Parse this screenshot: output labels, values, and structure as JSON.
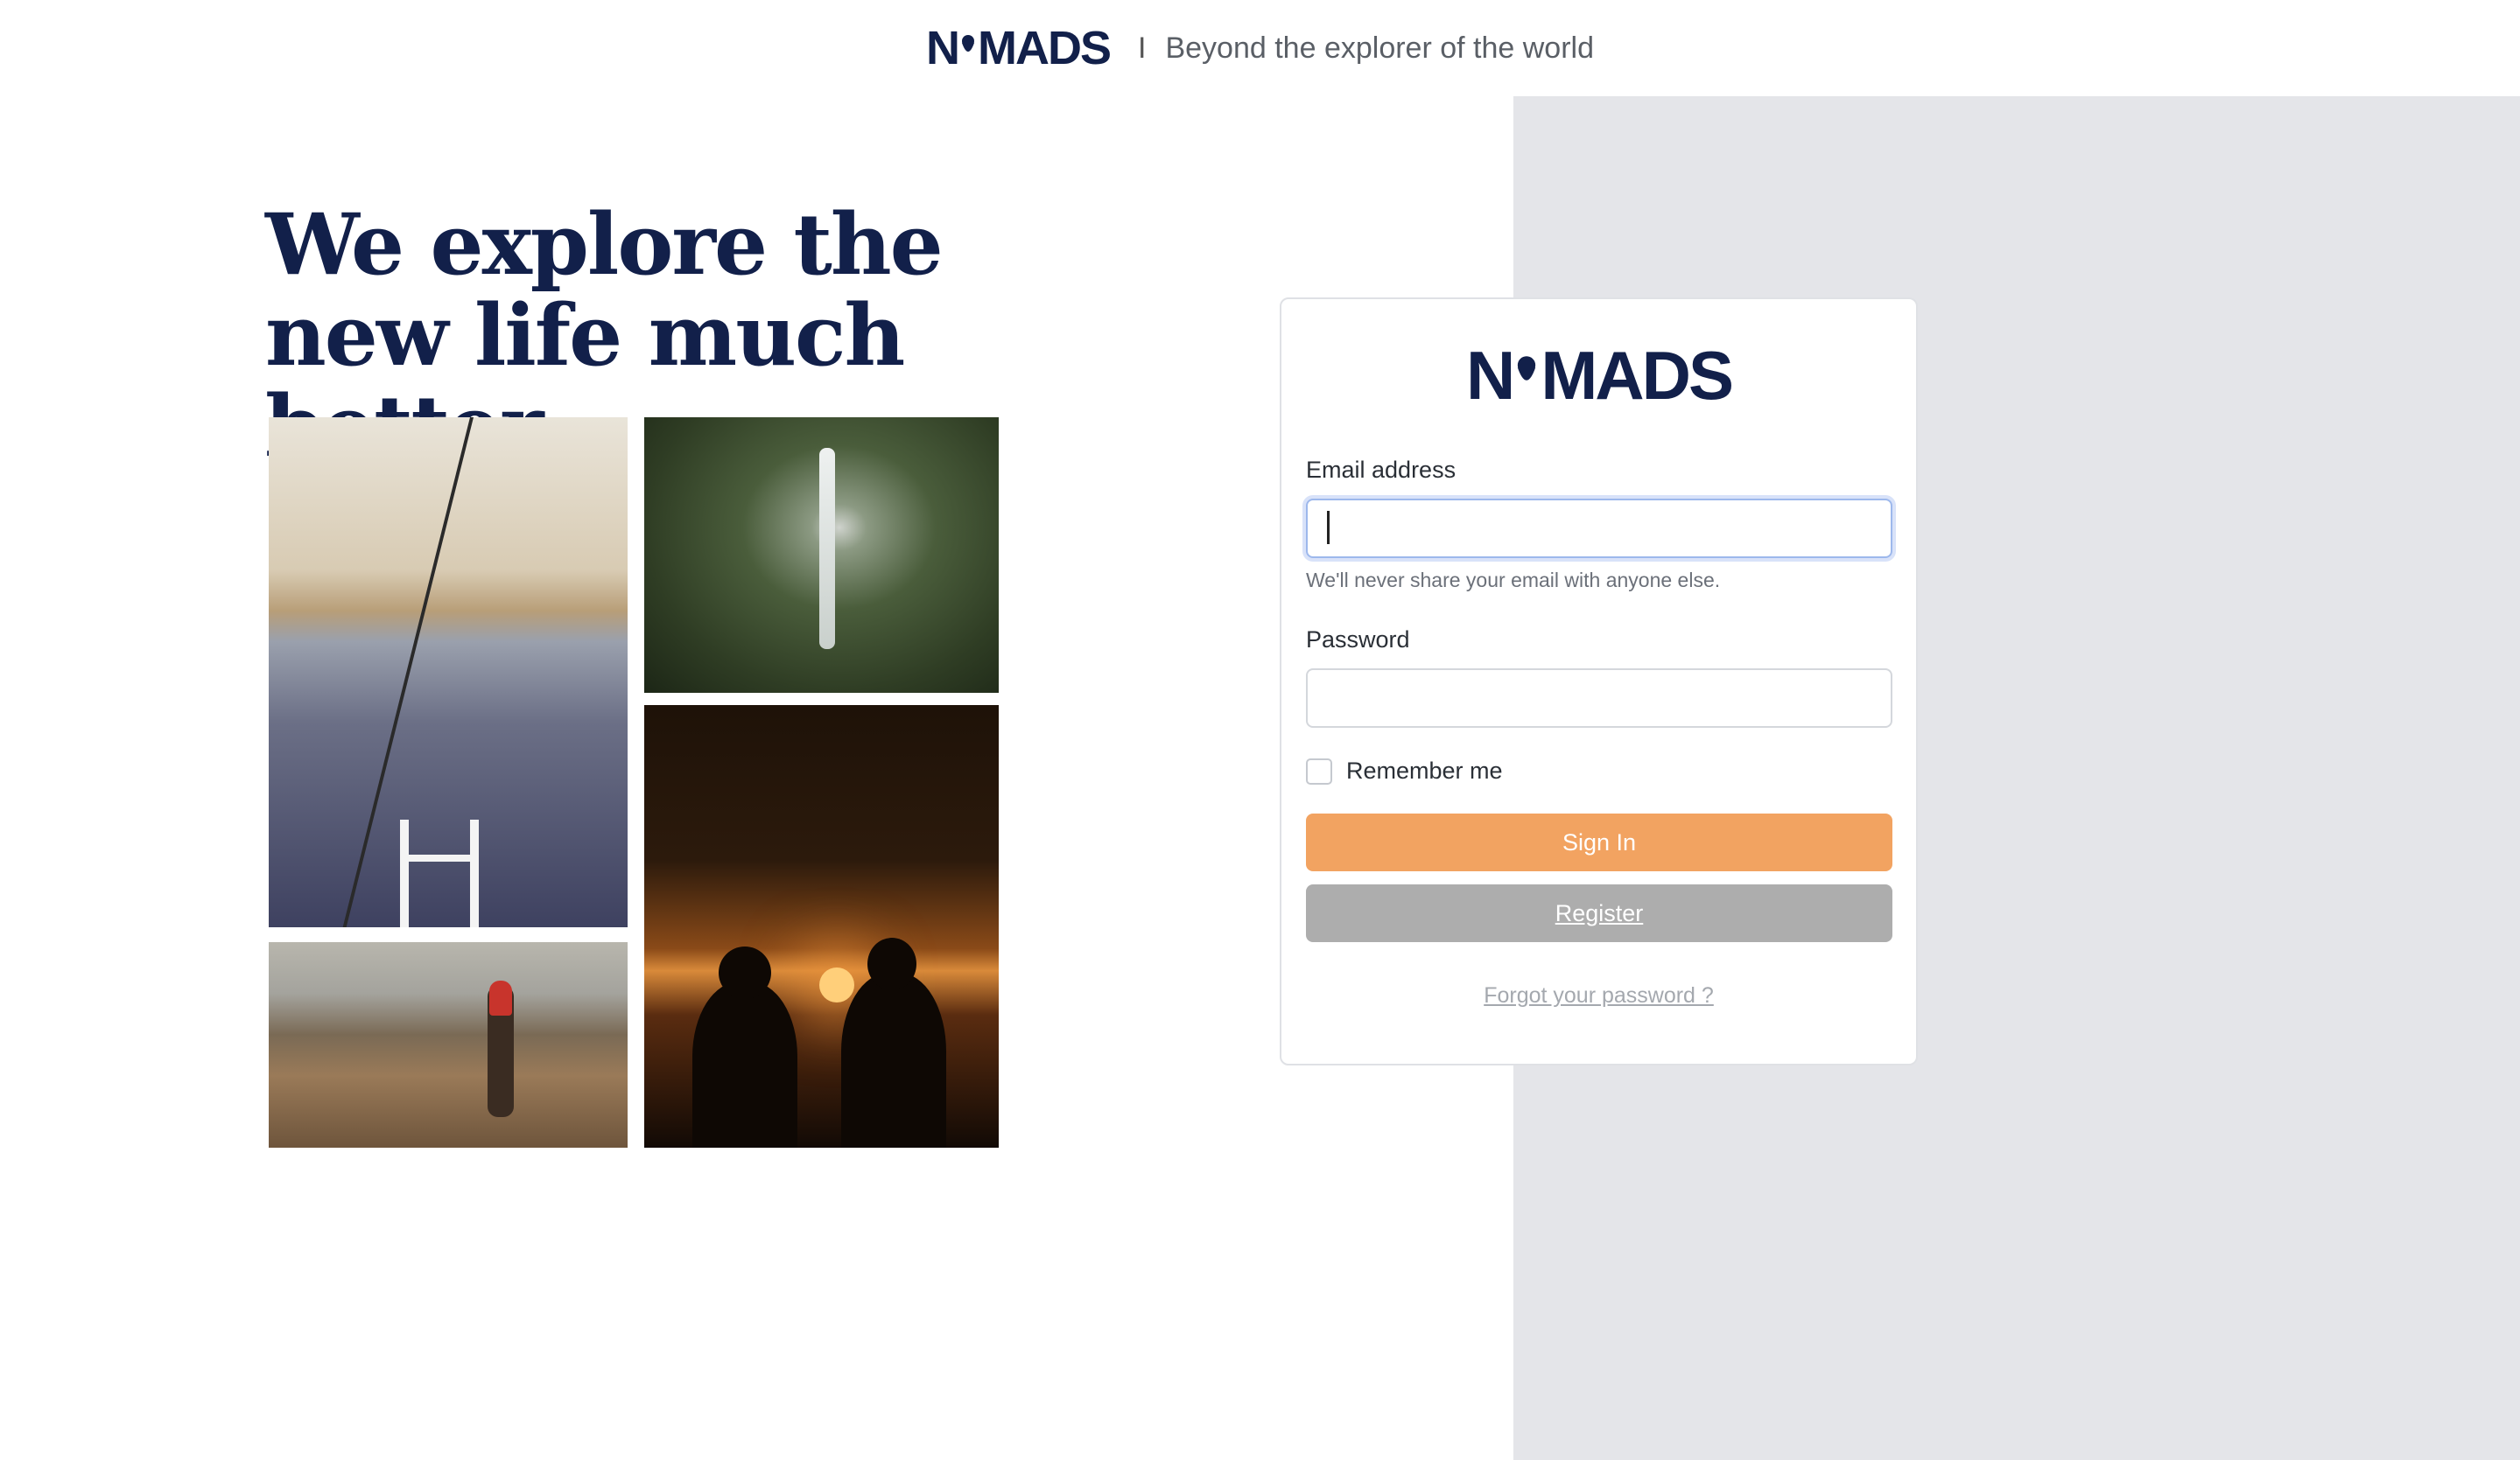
{
  "header": {
    "logo_text": "N",
    "logo_rest": "MADS",
    "separator": "I",
    "tagline": "Beyond the explorer of the world"
  },
  "hero": {
    "headline": "We explore the new life much better"
  },
  "login": {
    "logo_text": "N",
    "logo_rest": "MADS",
    "email_label": "Email address",
    "email_value": "",
    "email_help": "We'll never share your email with anyone else.",
    "password_label": "Password",
    "password_value": "",
    "remember_label": "Remember me",
    "remember_checked": false,
    "signin_label": "Sign In",
    "register_label": "Register",
    "forgot_label": "Forgot your password ?"
  },
  "colors": {
    "brand": "#12204a",
    "signin_button": "#f2a361",
    "register_button": "#adadad",
    "right_panel": "#e4e5e9"
  }
}
